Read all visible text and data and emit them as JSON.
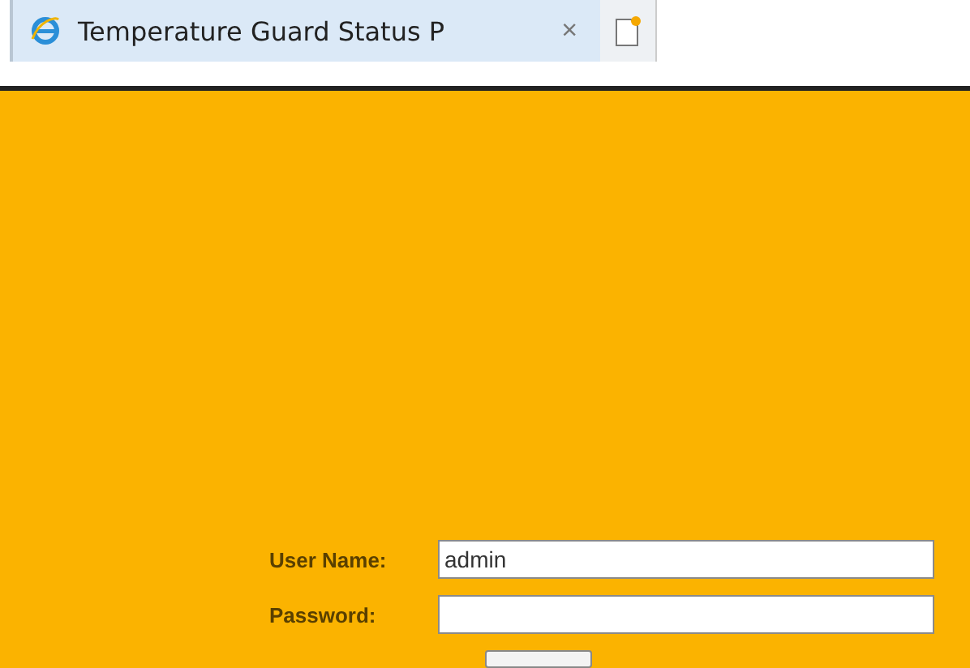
{
  "browser_tab": {
    "title": "Temperature Guard Status P",
    "close": "×"
  },
  "login_form": {
    "fields": [
      {
        "label": "User Name:",
        "value": "admin",
        "kind": "text"
      },
      {
        "label": "Password:",
        "kind": "password"
      }
    ]
  }
}
